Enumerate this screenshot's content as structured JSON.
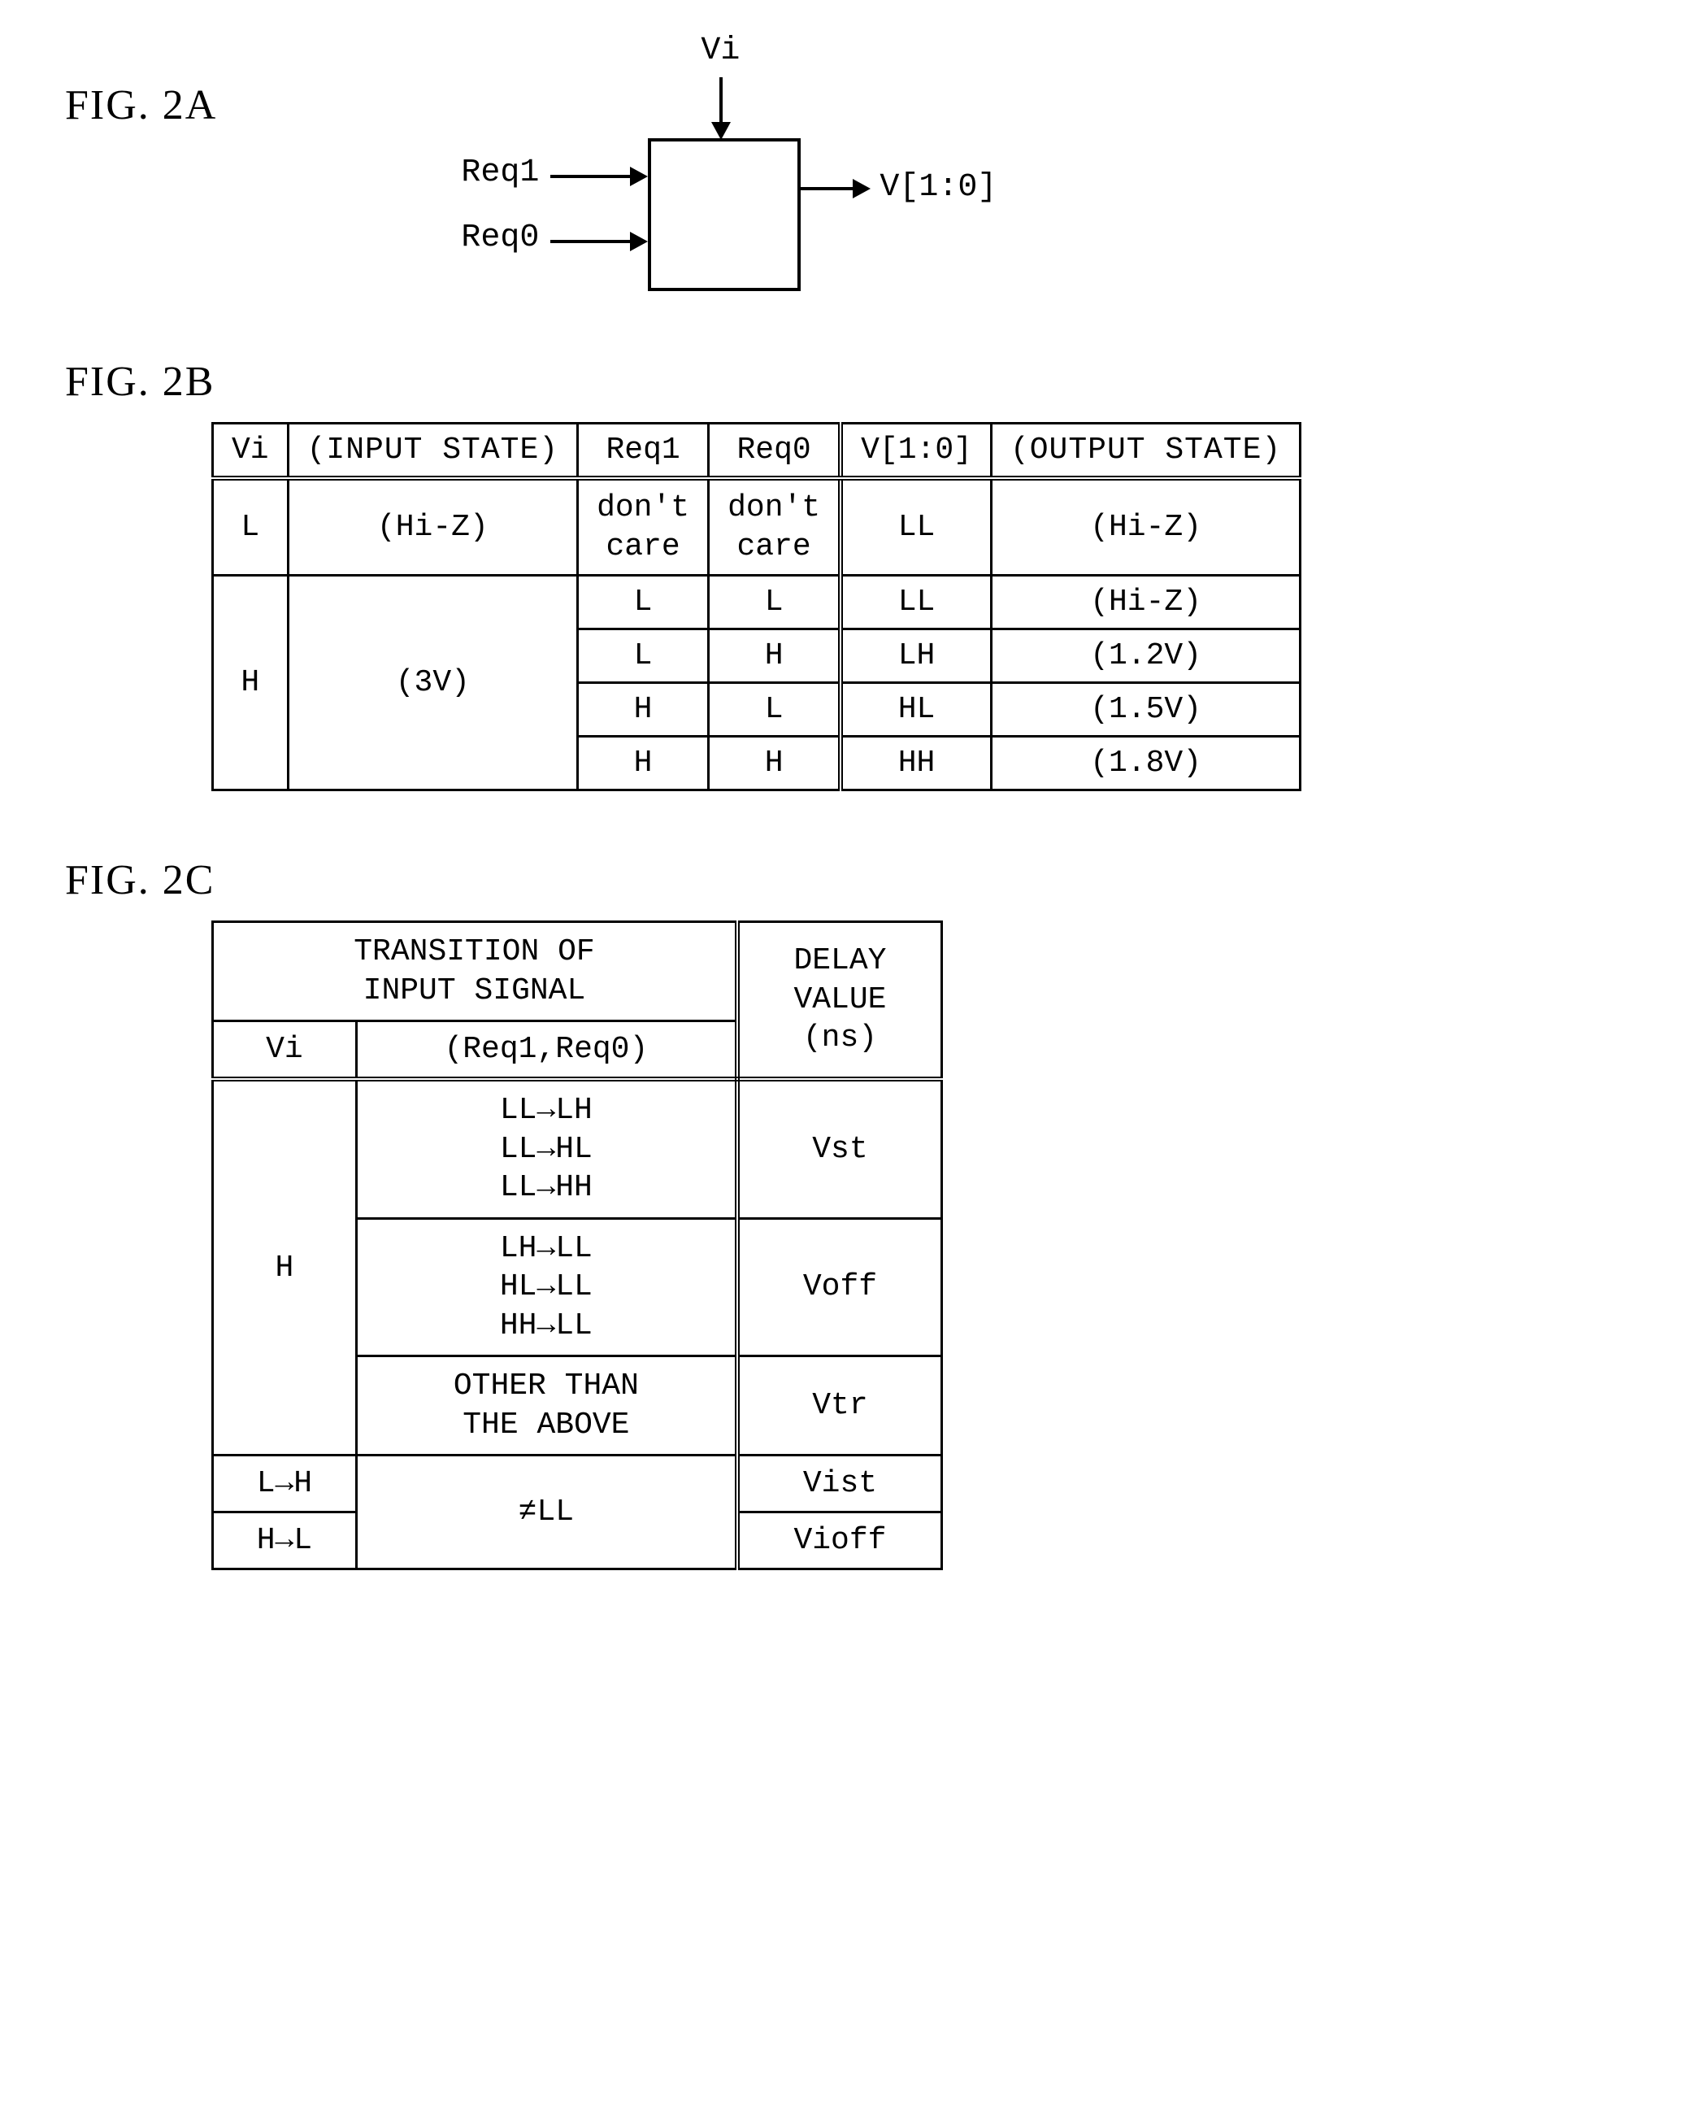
{
  "figA": {
    "label": "FIG. 2A",
    "sig_vi": "Vi",
    "sig_req1": "Req1",
    "sig_req0": "Req0",
    "sig_out": "V[1:0]"
  },
  "figB": {
    "label": "FIG. 2B",
    "head": {
      "vi": "Vi",
      "input_state": "(INPUT STATE)",
      "req1": "Req1",
      "req0": "Req0",
      "vout": "V[1:0]",
      "output_state": "(OUTPUT STATE)"
    },
    "rows": [
      {
        "vi": "L",
        "istate": "(Hi-Z)",
        "req1": "don't\ncare",
        "req0": "don't\ncare",
        "vout": "LL",
        "ostate": "(Hi-Z)"
      },
      {
        "vi": "H",
        "istate": "(3V)",
        "req1": "L",
        "req0": "L",
        "vout": "LL",
        "ostate": "(Hi-Z)"
      },
      {
        "vi": "",
        "istate": "",
        "req1": "L",
        "req0": "H",
        "vout": "LH",
        "ostate": "(1.2V)"
      },
      {
        "vi": "",
        "istate": "",
        "req1": "H",
        "req0": "L",
        "vout": "HL",
        "ostate": "(1.5V)"
      },
      {
        "vi": "",
        "istate": "",
        "req1": "H",
        "req0": "H",
        "vout": "HH",
        "ostate": "(1.8V)"
      }
    ]
  },
  "figC": {
    "label": "FIG. 2C",
    "head": {
      "transition": "TRANSITION OF\nINPUT SIGNAL",
      "vi": "Vi",
      "req": "(Req1,Req0)",
      "delay": "DELAY\nVALUE\n(ns)"
    },
    "rows": [
      {
        "vi": "H",
        "req": "LL→LH\nLL→HL\nLL→HH",
        "delay": "Vst"
      },
      {
        "vi": "",
        "req": "LH→LL\nHL→LL\nHH→LL",
        "delay": "Voff"
      },
      {
        "vi": "",
        "req": "OTHER THAN\nTHE ABOVE",
        "delay": "Vtr"
      },
      {
        "vi": "L→H",
        "req": "≠LL",
        "delay": "Vist"
      },
      {
        "vi": "H→L",
        "req": "",
        "delay": "Vioff"
      }
    ]
  }
}
